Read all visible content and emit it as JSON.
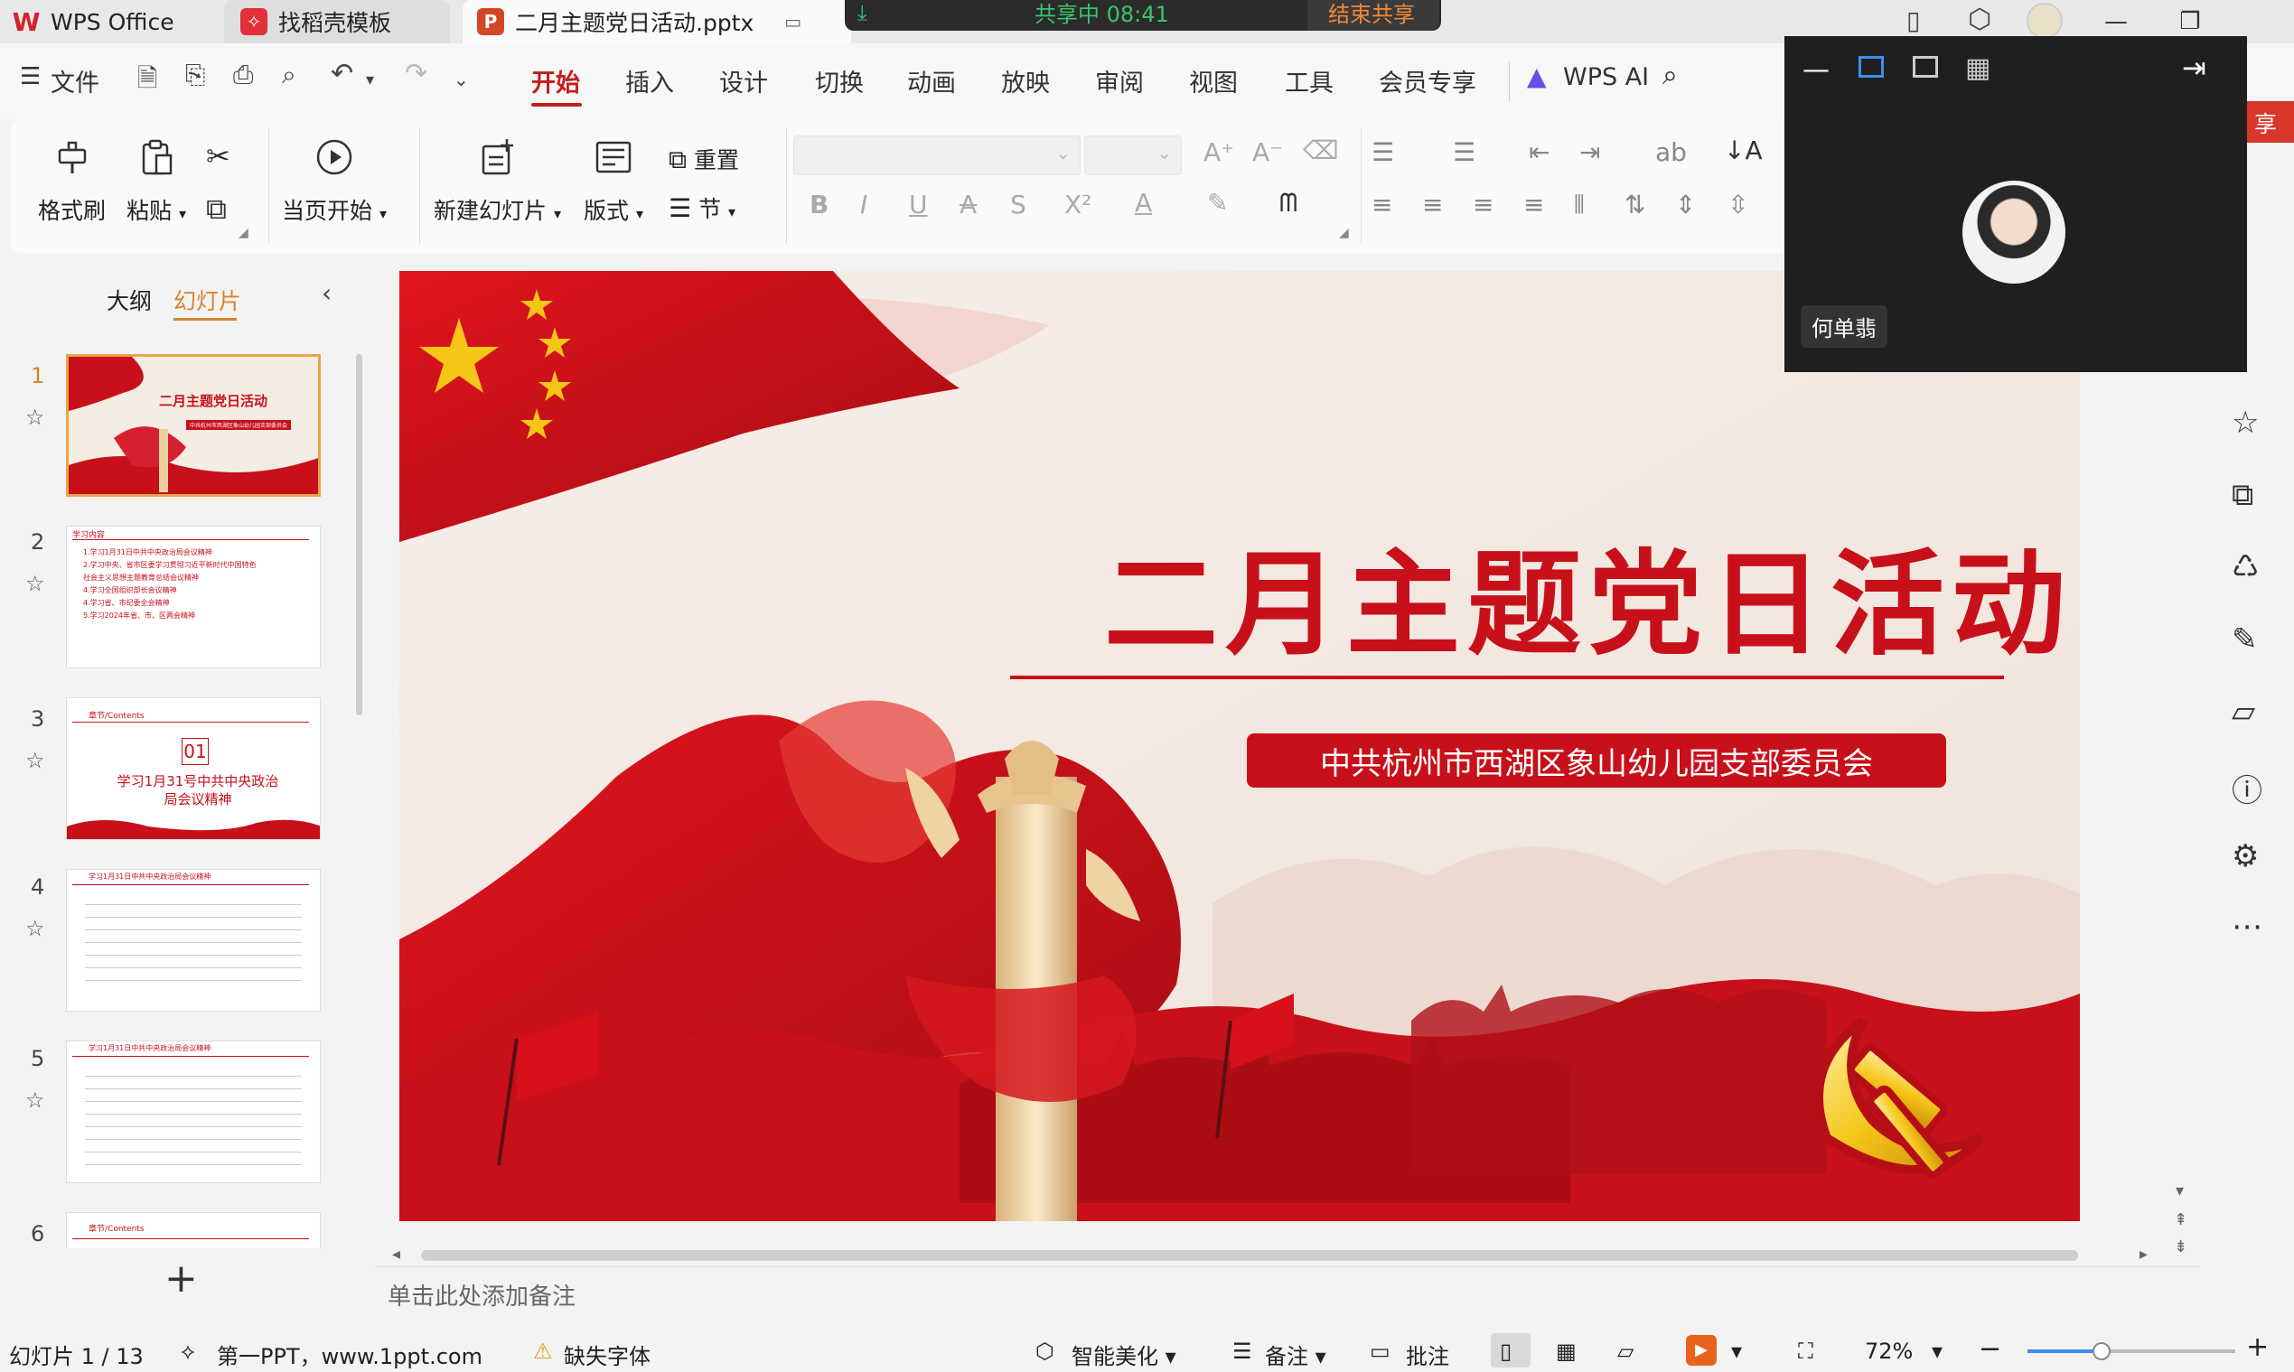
{
  "tabs": [
    {
      "label": "WPS Office",
      "icon": "wps-logo-icon"
    },
    {
      "label": "找稻壳模板",
      "icon": "docer-icon"
    },
    {
      "label": "二月主题党日活动.pptx",
      "icon": "ppt-file-icon"
    }
  ],
  "share_bar": {
    "status": "共享中  08:41",
    "end_label": "结束共享"
  },
  "menu": {
    "file": "文件",
    "items": [
      "开始",
      "插入",
      "设计",
      "切换",
      "动画",
      "放映",
      "审阅",
      "视图",
      "工具",
      "会员专享"
    ],
    "active": "开始",
    "ai": "WPS AI",
    "share_partial": "享"
  },
  "ribbon": {
    "format_painter": "格式刷",
    "paste": "粘贴",
    "start_from_current": "当页开始",
    "new_slide": "新建幻灯片",
    "layout": "版式",
    "section": "节",
    "reset": "重置"
  },
  "left_panel": {
    "outline_tab": "大纲",
    "slides_tab": "幻灯片",
    "slides": [
      {
        "num": "1",
        "title": "二月主题党日活动",
        "sub": "中共杭州市西湖区象山幼儿园支部委员会"
      },
      {
        "num": "2",
        "header": "学习内容",
        "lines": [
          "1.学习1月31日中共中央政治局会议精神",
          "2.学习中央、省市区委学习贯彻习近平新时代中国特色",
          "社会主义思想主题教育总结会议精神",
          "4.学习全国组织部长会议精神",
          "4.学习省、市纪委全会精神",
          "5.学习2024年省、市、区两会精神"
        ]
      },
      {
        "num": "3",
        "header": "章节/Contents",
        "badge": "01",
        "title": "学习1月31号中共中央政治局会议精神"
      },
      {
        "num": "4",
        "header": "学习1月31日中共中央政治局会议精神"
      },
      {
        "num": "5",
        "header": "学习1月31日中共中央政治局会议精神"
      },
      {
        "num": "6",
        "header": "章节/Contents"
      }
    ]
  },
  "slide": {
    "title": "二月主题党日活动",
    "subtitle": "中共杭州市西湖区象山幼儿园支部委员会"
  },
  "notes_placeholder": "单击此处添加备注",
  "video": {
    "participant": "何单翡"
  },
  "status": {
    "slide_counter": "幻灯片 1 / 13",
    "theme": "第一PPT，www.1ppt.com",
    "missing_font": "缺失字体",
    "beautify": "智能美化",
    "notes": "备注",
    "comments": "批注",
    "zoom": "72%"
  },
  "colors": {
    "accent": "#c21e1e",
    "slide_red": "#c8101a",
    "gold": "#f5c518"
  }
}
